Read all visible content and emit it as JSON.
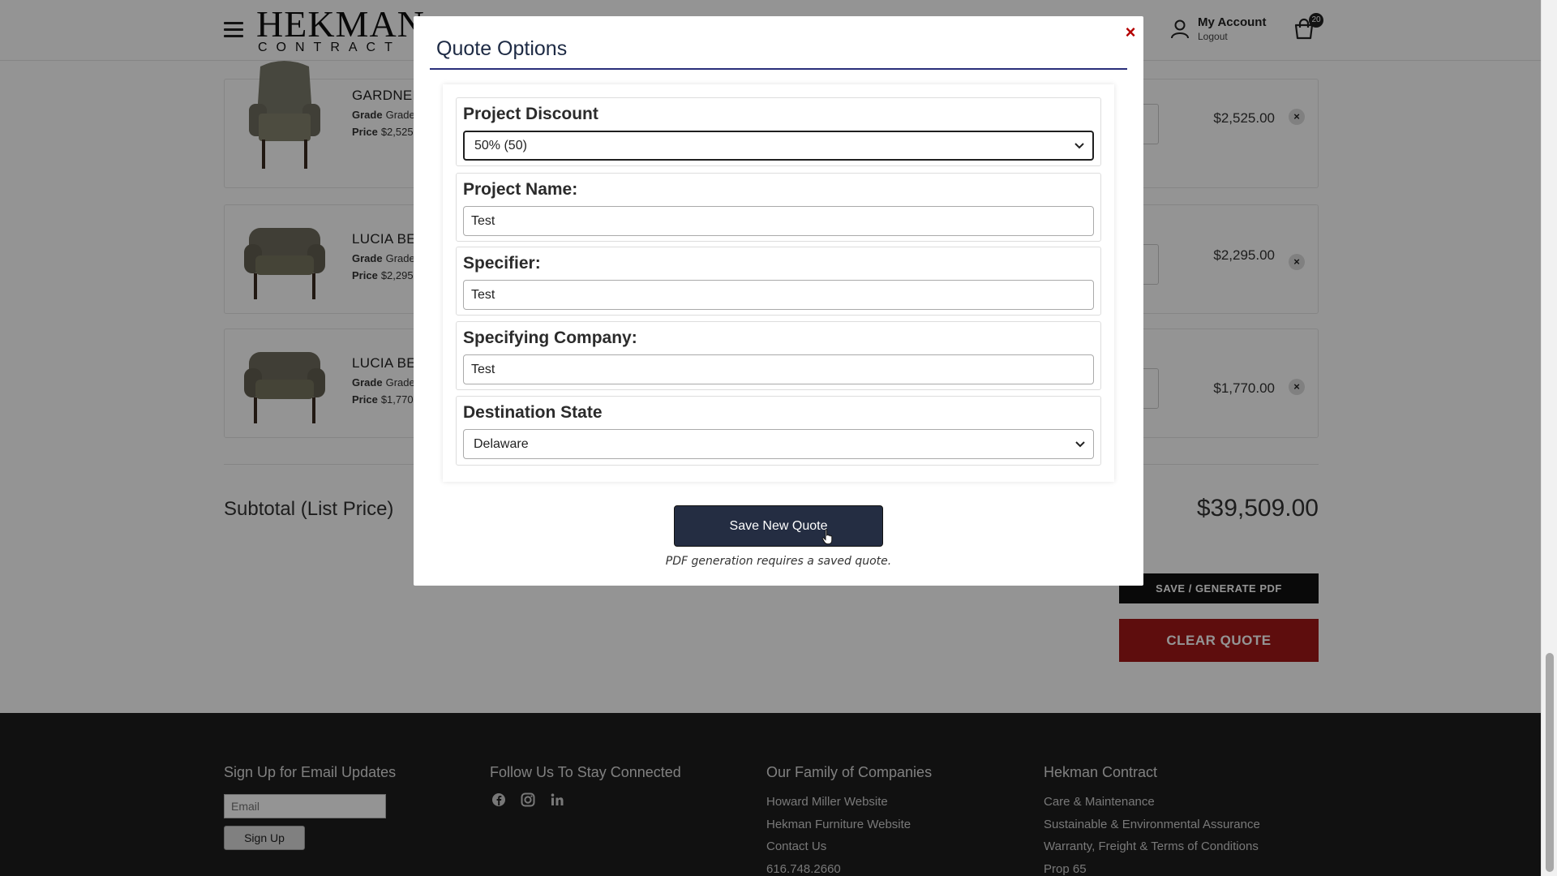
{
  "header": {
    "logo_line1": "HEKMAN",
    "logo_line2": "CONTRACT",
    "account_label": "My Account",
    "logout_label": "Logout",
    "cart_count": "20"
  },
  "items": [
    {
      "name": "GARDNER",
      "grade_label": "Grade",
      "grade_value": "Grade",
      "price_label": "Price",
      "price_value": "$2,525",
      "total": "$2,525.00",
      "remove": "×"
    },
    {
      "name": "LUCIA BE",
      "grade_label": "Grade",
      "grade_value": "Grade",
      "price_label": "Price",
      "price_value": "$2,295",
      "total": "$2,295.00",
      "remove": "×"
    },
    {
      "name": "LUCIA BE",
      "grade_label": "Grade",
      "grade_value": "Grade",
      "price_label": "Price",
      "price_value": "$1,770",
      "total": "$1,770.00",
      "remove": "×"
    }
  ],
  "summary": {
    "subtotal_label": "Subtotal (List Price)",
    "subtotal_value": "$39,509.00",
    "save_pdf_label": "SAVE / GENERATE PDF",
    "clear_label": "CLEAR QUOTE"
  },
  "footer": {
    "email_heading": "Sign Up for Email Updates",
    "email_placeholder": "Email",
    "signup_label": "Sign Up",
    "follow_heading": "Follow Us To Stay Connected",
    "family_heading": "Our Family of Companies",
    "family_links": [
      "Howard Miller Website",
      "Hekman Furniture Website",
      "Contact Us",
      "616.748.2660"
    ],
    "hekman_heading": "Hekman Contract",
    "hekman_links": [
      "Care & Maintenance",
      "Sustainable & Environmental Assurance",
      "Warranty, Freight & Terms of Conditions",
      "Prop 65"
    ]
  },
  "modal": {
    "title": "Quote Options",
    "close": "×",
    "discount_label": "Project Discount",
    "discount_value": "50% (50)",
    "project_name_label": "Project Name:",
    "project_name_value": "Test",
    "specifier_label": "Specifier:",
    "specifier_value": "Test",
    "company_label": "Specifying Company:",
    "company_value": "Test",
    "state_label": "Destination State",
    "state_value": "Delaware",
    "save_label": "Save New Quote",
    "note": "PDF generation requires a saved quote."
  },
  "icons": {
    "close": "close-icon",
    "account": "user-icon",
    "cart": "cart-icon",
    "facebook": "facebook-icon",
    "instagram": "instagram-icon",
    "linkedin": "linkedin-icon"
  }
}
